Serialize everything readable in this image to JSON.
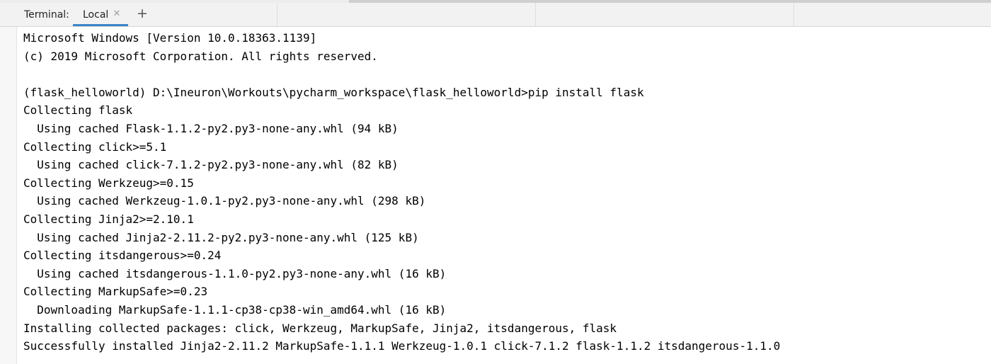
{
  "tabbar": {
    "label": "Terminal:",
    "active_tab": "Local",
    "close_glyph": "✕",
    "add_glyph": "+"
  },
  "terminal": {
    "lines": [
      "Microsoft Windows [Version 10.0.18363.1139]",
      "(c) 2019 Microsoft Corporation. All rights reserved.",
      "",
      "(flask_helloworld) D:\\Ineuron\\Workouts\\pycharm_workspace\\flask_helloworld>pip install flask",
      "Collecting flask",
      "  Using cached Flask-1.1.2-py2.py3-none-any.whl (94 kB)",
      "Collecting click>=5.1",
      "  Using cached click-7.1.2-py2.py3-none-any.whl (82 kB)",
      "Collecting Werkzeug>=0.15",
      "  Using cached Werkzeug-1.0.1-py2.py3-none-any.whl (298 kB)",
      "Collecting Jinja2>=2.10.1",
      "  Using cached Jinja2-2.11.2-py2.py3-none-any.whl (125 kB)",
      "Collecting itsdangerous>=0.24",
      "  Using cached itsdangerous-1.1.0-py2.py3-none-any.whl (16 kB)",
      "Collecting MarkupSafe>=0.23",
      "  Downloading MarkupSafe-1.1.1-cp38-cp38-win_amd64.whl (16 kB)",
      "Installing collected packages: click, Werkzeug, MarkupSafe, Jinja2, itsdangerous, flask",
      "Successfully installed Jinja2-2.11.2 MarkupSafe-1.1.1 Werkzeug-1.0.1 click-7.1.2 flask-1.1.2 itsdangerous-1.1.0"
    ]
  }
}
